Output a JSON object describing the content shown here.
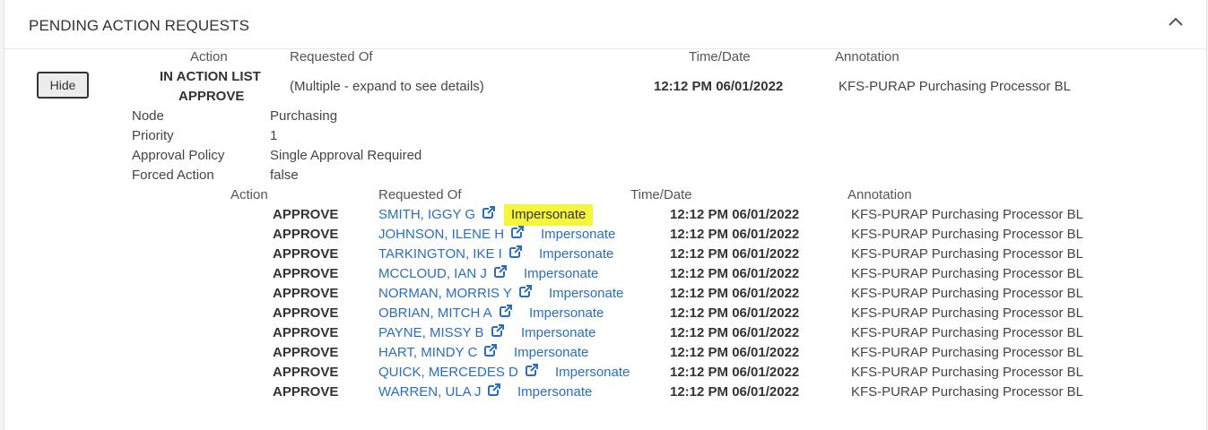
{
  "header": {
    "title": "PENDING ACTION REQUESTS",
    "collapse_icon": "chevron-up-icon"
  },
  "top_table": {
    "columns": [
      "Action",
      "Requested Of",
      "Time/Date",
      "Annotation"
    ],
    "hide_label": "Hide",
    "action_line1": "IN ACTION LIST",
    "action_line2": "APPROVE",
    "requested_of": "(Multiple - expand to see details)",
    "time_date": "12:12 PM 06/01/2022",
    "annotation": "KFS-PURAP Purchasing Processor BL"
  },
  "details": [
    {
      "label": "Node",
      "value": "Purchasing"
    },
    {
      "label": "Priority",
      "value": "1"
    },
    {
      "label": "Approval Policy",
      "value": "Single Approval Required"
    },
    {
      "label": "Forced Action",
      "value": "false"
    }
  ],
  "sub_table": {
    "columns": [
      "Action",
      "Requested Of",
      "Time/Date",
      "Annotation"
    ],
    "impersonate_label": "Impersonate",
    "link_icon": "external-link-icon",
    "highlight_color": "#f5f53b",
    "rows": [
      {
        "action": "APPROVE",
        "name": "SMITH, IGGY G",
        "time": "12:12 PM 06/01/2022",
        "annotation": "KFS-PURAP Purchasing Processor BL",
        "highlighted": true
      },
      {
        "action": "APPROVE",
        "name": "JOHNSON, ILENE H",
        "time": "12:12 PM 06/01/2022",
        "annotation": "KFS-PURAP Purchasing Processor BL"
      },
      {
        "action": "APPROVE",
        "name": "TARKINGTON, IKE I",
        "time": "12:12 PM 06/01/2022",
        "annotation": "KFS-PURAP Purchasing Processor BL"
      },
      {
        "action": "APPROVE",
        "name": "MCCLOUD, IAN J",
        "time": "12:12 PM 06/01/2022",
        "annotation": "KFS-PURAP Purchasing Processor BL"
      },
      {
        "action": "APPROVE",
        "name": "NORMAN, MORRIS Y",
        "time": "12:12 PM 06/01/2022",
        "annotation": "KFS-PURAP Purchasing Processor BL"
      },
      {
        "action": "APPROVE",
        "name": "OBRIAN, MITCH A",
        "time": "12:12 PM 06/01/2022",
        "annotation": "KFS-PURAP Purchasing Processor BL"
      },
      {
        "action": "APPROVE",
        "name": "PAYNE, MISSY B",
        "time": "12:12 PM 06/01/2022",
        "annotation": "KFS-PURAP Purchasing Processor BL"
      },
      {
        "action": "APPROVE",
        "name": "HART, MINDY C",
        "time": "12:12 PM 06/01/2022",
        "annotation": "KFS-PURAP Purchasing Processor BL"
      },
      {
        "action": "APPROVE",
        "name": "QUICK, MERCEDES D",
        "time": "12:12 PM 06/01/2022",
        "annotation": "KFS-PURAP Purchasing Processor BL"
      },
      {
        "action": "APPROVE",
        "name": "WARREN, ULA J",
        "time": "12:12 PM 06/01/2022",
        "annotation": "KFS-PURAP Purchasing Processor BL"
      }
    ]
  }
}
